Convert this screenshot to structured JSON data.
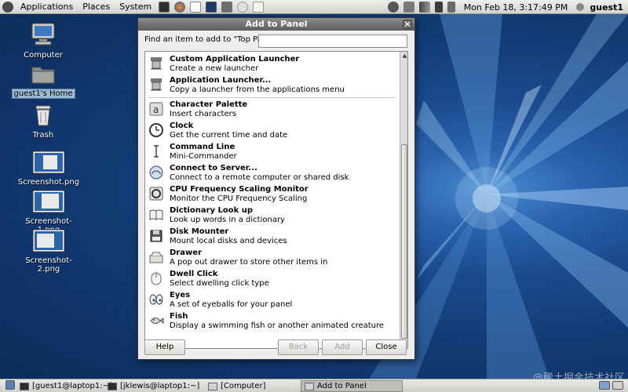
{
  "top_panel": {
    "menus": [
      "Applications",
      "Places",
      "System"
    ],
    "clock": "Mon Feb 18,  3:17:49 PM",
    "user": "guest1"
  },
  "desktop": {
    "icons": [
      {
        "label": "Computer"
      },
      {
        "label": "guest1's Home"
      },
      {
        "label": "Trash"
      },
      {
        "label": "Screenshot.png"
      },
      {
        "label": "Screenshot-1.png"
      },
      {
        "label": "Screenshot-2.png"
      }
    ]
  },
  "dialog": {
    "title": "Add to Panel",
    "find_label": "Find an item to add to \"Top Panel\":",
    "find_value": "",
    "items": [
      {
        "name": "Custom Application Launcher",
        "desc": "Create a new launcher",
        "icon": "launcher-icon"
      },
      {
        "name": "Application Launcher...",
        "desc": "Copy a launcher from the applications menu",
        "icon": "launcher-icon"
      },
      {
        "name": "Character Palette",
        "desc": "Insert characters",
        "icon": "character-palette-icon"
      },
      {
        "name": "Clock",
        "desc": "Get the current time and date",
        "icon": "clock-icon"
      },
      {
        "name": "Command Line",
        "desc": "Mini-Commander",
        "icon": "command-line-icon"
      },
      {
        "name": "Connect to Server...",
        "desc": "Connect to a remote computer or shared disk",
        "icon": "connect-server-icon"
      },
      {
        "name": "CPU Frequency Scaling Monitor",
        "desc": "Monitor the CPU Frequency Scaling",
        "icon": "cpu-monitor-icon"
      },
      {
        "name": "Dictionary Look up",
        "desc": "Look up words in a dictionary",
        "icon": "dictionary-icon"
      },
      {
        "name": "Disk Mounter",
        "desc": "Mount local disks and devices",
        "icon": "disk-mounter-icon"
      },
      {
        "name": "Drawer",
        "desc": "A pop out drawer to store other items in",
        "icon": "drawer-icon"
      },
      {
        "name": "Dwell Click",
        "desc": "Select dwelling click type",
        "icon": "dwell-click-icon"
      },
      {
        "name": "Eyes",
        "desc": "A set of eyeballs for your panel",
        "icon": "eyes-icon"
      },
      {
        "name": "Fish",
        "desc": "Display a swimming fish or another animated creature",
        "icon": "fish-icon"
      }
    ],
    "buttons": {
      "help": "Help",
      "back": "Back",
      "add": "Add",
      "close": "Close"
    }
  },
  "taskbar": {
    "tasks": [
      {
        "label": "[guest1@laptop1:~]",
        "active": false
      },
      {
        "label": "[jklewis@laptop1:~]",
        "active": false
      },
      {
        "label": "[Computer]",
        "active": false
      },
      {
        "label": "Add to Panel",
        "active": true
      }
    ]
  },
  "watermark": "@稀土掘金技术社区"
}
